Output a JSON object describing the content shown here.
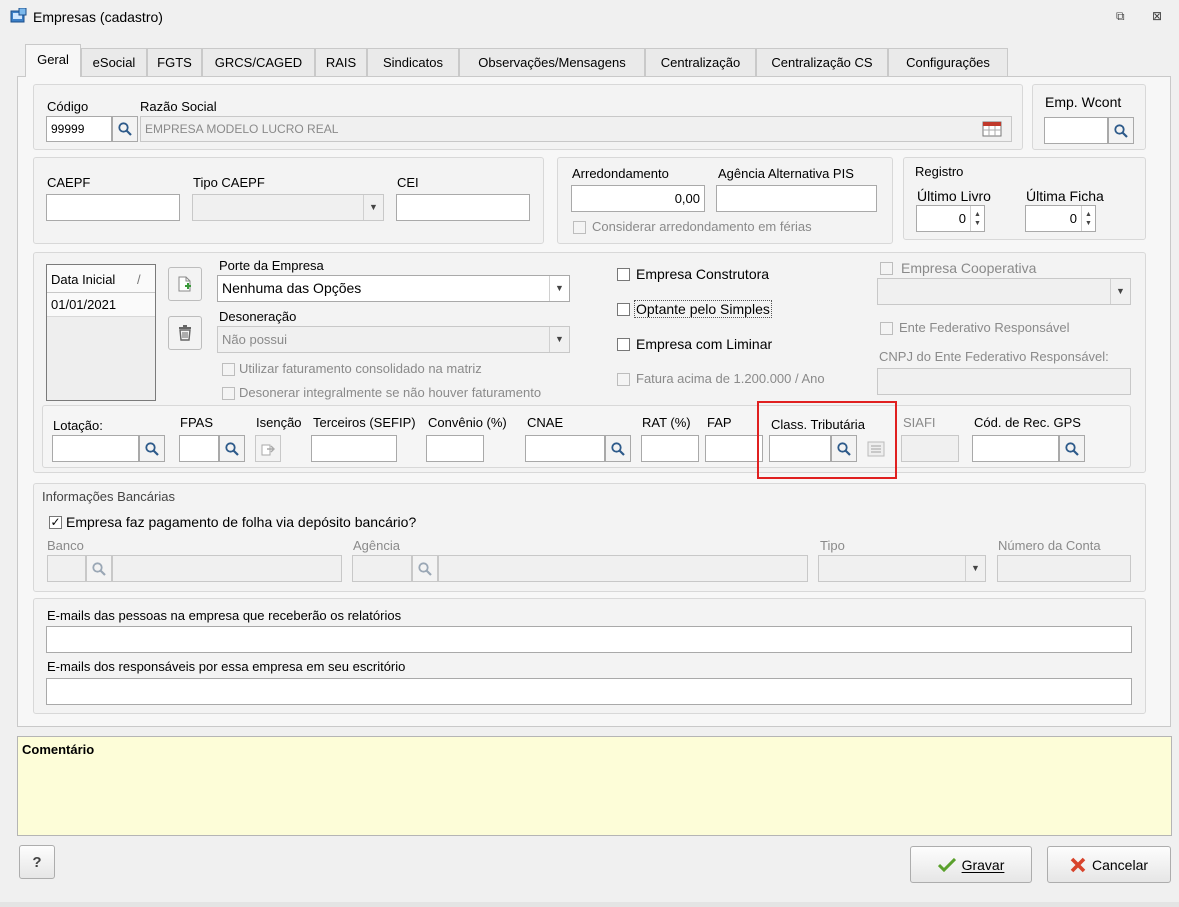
{
  "window": {
    "title": "Empresas (cadastro)",
    "restore_glyph": "⧉",
    "close_glyph": "⊠"
  },
  "tabs": [
    "Geral",
    "eSocial",
    "FGTS",
    "GRCS/CAGED",
    "RAIS",
    "Sindicatos",
    "Observações/Mensagens",
    "Centralização",
    "Centralização CS",
    "Configurações"
  ],
  "ident": {
    "codigo_label": "Código",
    "codigo_value": "99999",
    "razao_label": "Razão Social",
    "razao_value": "EMPRESA MODELO LUCRO REAL",
    "emp_wcont_label": "Emp. Wcont",
    "emp_wcont_value": ""
  },
  "caepf": {
    "caepf_label": "CAEPF",
    "tipo_label": "Tipo CAEPF",
    "cei_label": "CEI"
  },
  "arred": {
    "label": "Arredondamento",
    "value": "0,00",
    "agencia_label": "Agência Alternativa PIS",
    "considerar_label": "Considerar arredondamento em férias"
  },
  "registro": {
    "group_label": "Registro",
    "livro_label": "Último Livro",
    "livro_value": "0",
    "ficha_label": "Última Ficha",
    "ficha_value": "0"
  },
  "grid": {
    "header": "Data Inicial",
    "sort_glyph": "/",
    "row1": "01/01/2021"
  },
  "porte": {
    "label": "Porte da Empresa",
    "value": "Nenhuma das Opções",
    "deson_label": "Desoneração",
    "deson_value": "Não possui",
    "utilizar_label": "Utilizar faturamento consolidado na matriz",
    "desonerar_label": "Desonerar integralmente se não houver faturamento"
  },
  "flags": {
    "construtora": "Empresa Construtora",
    "simples": "Optante pelo Simples",
    "liminar": "Empresa com Liminar",
    "fatura": "Fatura acima de 1.200.000 / Ano",
    "cooperativa": "Empresa Cooperativa",
    "ente": "Ente Federativo Responsável",
    "cnpj_ente": "CNPJ do Ente Federativo Responsável:"
  },
  "fields_row": {
    "lotacao": "Lotação:",
    "fpas": "FPAS",
    "isencao": "Isenção",
    "terceiros": "Terceiros (SEFIP)",
    "convenio": "Convênio (%)",
    "cnae": "CNAE",
    "rat": "RAT (%)",
    "fap": "FAP",
    "class_trib": "Class. Tributária",
    "siafi": "SIAFI",
    "cod_rec_gps": "Cód. de Rec. GPS"
  },
  "bancarias": {
    "group_label": "Informações Bancárias",
    "deposito_label": "Empresa faz pagamento de folha via depósito bancário?",
    "deposito_checked": true,
    "banco_label": "Banco",
    "agencia_label": "Agência",
    "tipo_label": "Tipo",
    "conta_label": "Número da Conta"
  },
  "emails": {
    "relatorios_label": "E-mails das pessoas na empresa que receberão os relatórios",
    "escritorio_label": "E-mails dos responsáveis por essa empresa em seu escritório"
  },
  "comentario": {
    "label": "Comentário"
  },
  "footer": {
    "help": "?",
    "gravar": "Gravar",
    "cancelar": "Cancelar"
  },
  "colors": {
    "highlight": "#e02020",
    "comment_bg": "#fdfdd8",
    "check_green": "#5aa02c",
    "cancel_red": "#d8432b"
  },
  "icons": [
    "window-app-icon",
    "search-icon",
    "calendar-table-icon",
    "add-document-icon",
    "trash-icon",
    "copy-icon",
    "list-icon",
    "check-icon",
    "cancel-x-icon"
  ]
}
